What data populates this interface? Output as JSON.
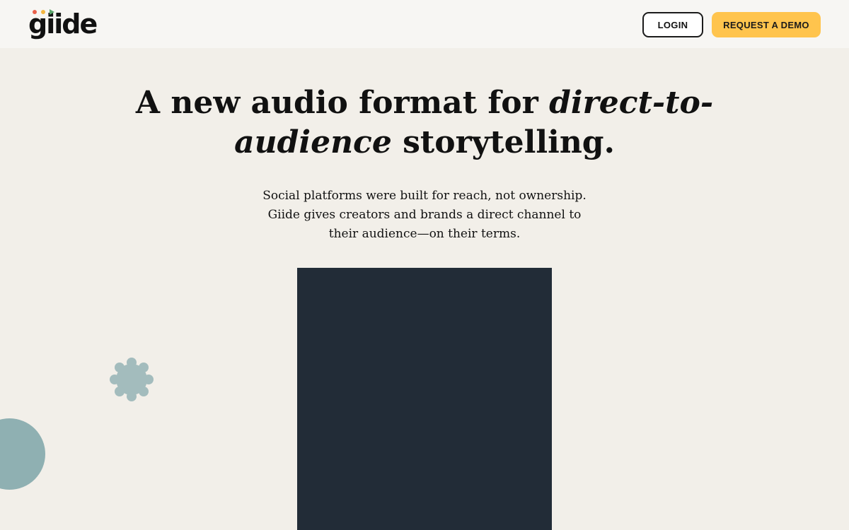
{
  "header": {
    "logo_text": "giide",
    "logo_dot_colors": [
      "#e8604a",
      "#f4b63f",
      "#5aa56b"
    ],
    "login_label": "LOGIN",
    "demo_label": "REQUEST A DEMO"
  },
  "hero": {
    "title_part1": "A new audio format for ",
    "title_italic1": "direct-to-",
    "title_italic2": "audience",
    "title_part2": " storytelling.",
    "subtitle": "Social platforms were built for reach, not ownership. Giide gives creators and brands a direct channel to their audience—on their terms."
  },
  "colors": {
    "background": "#f2efe9",
    "header_background": "#f7f6f3",
    "accent_yellow": "#ffc44d",
    "panel_dark": "#222c37",
    "shape_teal": "#8fb0b2",
    "gear_teal": "#a3bcbd"
  }
}
